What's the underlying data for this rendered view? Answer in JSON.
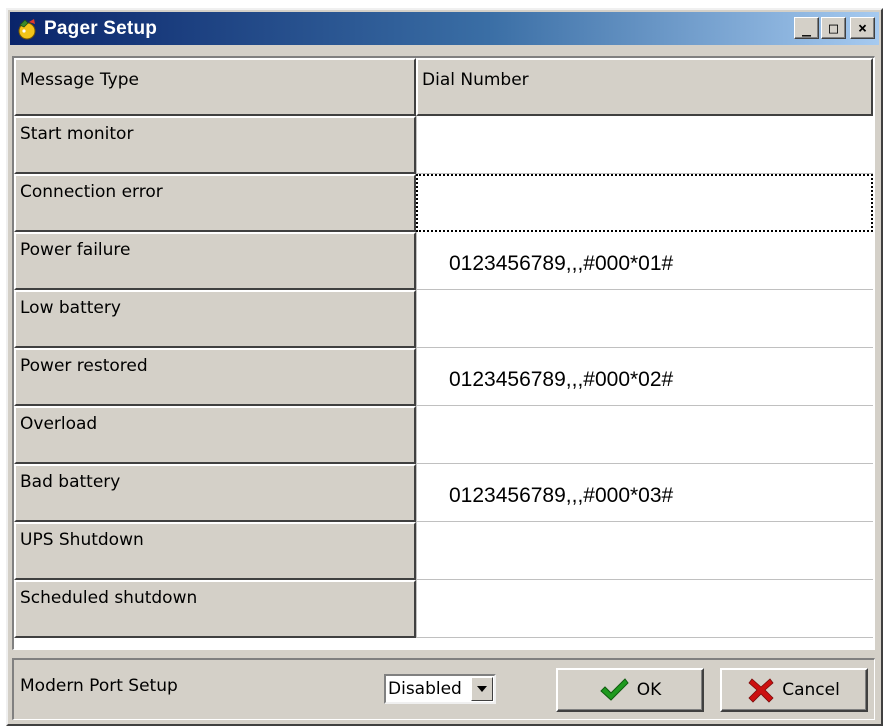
{
  "window": {
    "title": "Pager Setup"
  },
  "title_buttons": {
    "minimize": "_",
    "maximize": "□",
    "close": "×"
  },
  "table": {
    "headers": [
      "Message Type",
      "Dial Number"
    ],
    "rows": [
      {
        "type": "Start monitor",
        "number": ""
      },
      {
        "type": "Connection error",
        "number": ""
      },
      {
        "type": "Power failure",
        "number": "0123456789,,,#000*01#"
      },
      {
        "type": "Low battery",
        "number": ""
      },
      {
        "type": "Power restored",
        "number": "0123456789,,,#000*02#"
      },
      {
        "type": "Overload",
        "number": ""
      },
      {
        "type": "Bad battery",
        "number": "0123456789,,,#000*03#"
      },
      {
        "type": "UPS Shutdown",
        "number": ""
      },
      {
        "type": "Scheduled shutdown",
        "number": ""
      }
    ]
  },
  "footer": {
    "modem_label": "Modern Port Setup",
    "port_select": {
      "value": "Disabled"
    },
    "ok_label": "OK",
    "cancel_label": "Cancel"
  },
  "colors": {
    "face": "#d4d0c8",
    "title_start": "#0a246a",
    "title_end": "#a6caf0",
    "ok_check": "#1f9a1f",
    "cancel_x": "#cc1010"
  },
  "icons": {
    "app": "pager-app-icon",
    "ok": "checkmark-icon",
    "cancel": "x-icon",
    "dropdown": "triangle-down-icon"
  }
}
